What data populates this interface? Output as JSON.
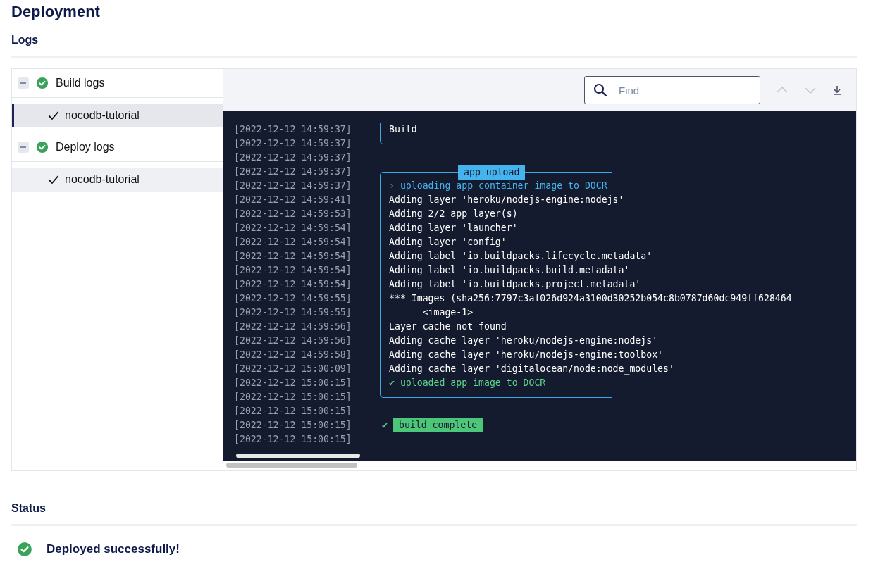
{
  "page": {
    "title": "Deployment"
  },
  "logs": {
    "heading": "Logs",
    "sidebar": {
      "groups": [
        {
          "label": "Build logs",
          "expanded": true,
          "children": [
            {
              "label": "nocodb-tutorial",
              "selected": true
            }
          ]
        },
        {
          "label": "Deploy logs",
          "expanded": true,
          "children": [
            {
              "label": "nocodb-tutorial",
              "selected": false
            }
          ]
        }
      ]
    },
    "search": {
      "placeholder": "Find"
    },
    "lines": [
      {
        "time": "[2022-12-12 14:59:37]",
        "kind": "box-title",
        "text": "Build"
      },
      {
        "time": "[2022-12-12 14:59:37]",
        "kind": "box-end"
      },
      {
        "time": "[2022-12-12 14:59:37]",
        "kind": "blank"
      },
      {
        "time": "[2022-12-12 14:59:37]",
        "kind": "box-start",
        "text": "app upload"
      },
      {
        "time": "[2022-12-12 14:59:37]",
        "kind": "step",
        "text": "› uploading app container image to DOCR"
      },
      {
        "time": "[2022-12-12 14:59:41]",
        "kind": "box-line",
        "text": "Adding layer 'heroku/nodejs-engine:nodejs'"
      },
      {
        "time": "[2022-12-12 14:59:53]",
        "kind": "box-line",
        "text": "Adding 2/2 app layer(s)"
      },
      {
        "time": "[2022-12-12 14:59:54]",
        "kind": "box-line",
        "text": "Adding layer 'launcher'"
      },
      {
        "time": "[2022-12-12 14:59:54]",
        "kind": "box-line",
        "text": "Adding layer 'config'"
      },
      {
        "time": "[2022-12-12 14:59:54]",
        "kind": "box-line",
        "text": "Adding label 'io.buildpacks.lifecycle.metadata'"
      },
      {
        "time": "[2022-12-12 14:59:54]",
        "kind": "box-line",
        "text": "Adding label 'io.buildpacks.build.metadata'"
      },
      {
        "time": "[2022-12-12 14:59:54]",
        "kind": "box-line",
        "text": "Adding label 'io.buildpacks.project.metadata'"
      },
      {
        "time": "[2022-12-12 14:59:55]",
        "kind": "box-line",
        "text": "*** Images (sha256:7797c3af026d924a3100d30252b054c8b0787d60dc949ff628464"
      },
      {
        "time": "[2022-12-12 14:59:55]",
        "kind": "box-line",
        "text": "      <image-1>"
      },
      {
        "time": "[2022-12-12 14:59:56]",
        "kind": "box-line",
        "text": "Layer cache not found"
      },
      {
        "time": "[2022-12-12 14:59:56]",
        "kind": "box-line",
        "text": "Adding cache layer 'heroku/nodejs-engine:nodejs'"
      },
      {
        "time": "[2022-12-12 14:59:58]",
        "kind": "box-line",
        "text": "Adding cache layer 'heroku/nodejs-engine:toolbox'"
      },
      {
        "time": "[2022-12-12 15:00:09]",
        "kind": "box-line",
        "text": "Adding cache layer 'digitalocean/node:node_modules'"
      },
      {
        "time": "[2022-12-12 15:00:15]",
        "kind": "success",
        "text": "✔ uploaded app image to DOCR"
      },
      {
        "time": "[2022-12-12 15:00:15]",
        "kind": "box-end"
      },
      {
        "time": "[2022-12-12 15:00:15]",
        "kind": "blank"
      },
      {
        "time": "[2022-12-12 15:00:15]",
        "kind": "complete",
        "mark": "✔",
        "text": "build complete"
      },
      {
        "time": "[2022-12-12 15:00:15]",
        "kind": "blank"
      }
    ]
  },
  "status": {
    "heading": "Status",
    "text": "Deployed successfully!"
  }
}
